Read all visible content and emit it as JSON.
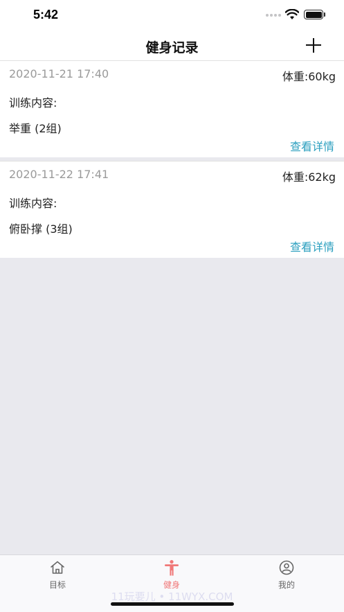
{
  "status": {
    "time": "5:42"
  },
  "nav": {
    "title": "健身记录"
  },
  "records": [
    {
      "date": "2020-11-21 17:40",
      "weight": "体重:60kg",
      "label": "训练内容:",
      "exercise": "举重 (2组)",
      "detail": "查看详情"
    },
    {
      "date": "2020-11-22 17:41",
      "weight": "体重:62kg",
      "label": "训练内容:",
      "exercise": "俯卧撑 (3组)",
      "detail": "查看详情"
    }
  ],
  "tabs": [
    {
      "label": "目标",
      "icon": "home-icon",
      "active": false
    },
    {
      "label": "健身",
      "icon": "person-fitness-icon",
      "active": true
    },
    {
      "label": "我的",
      "icon": "user-circle-icon",
      "active": false
    }
  ],
  "watermark": "11玩要儿 • 11WYX.COM",
  "colors": {
    "accent": "#2b9fbf",
    "active_tab": "#f07878",
    "background": "#e9e9ee"
  }
}
